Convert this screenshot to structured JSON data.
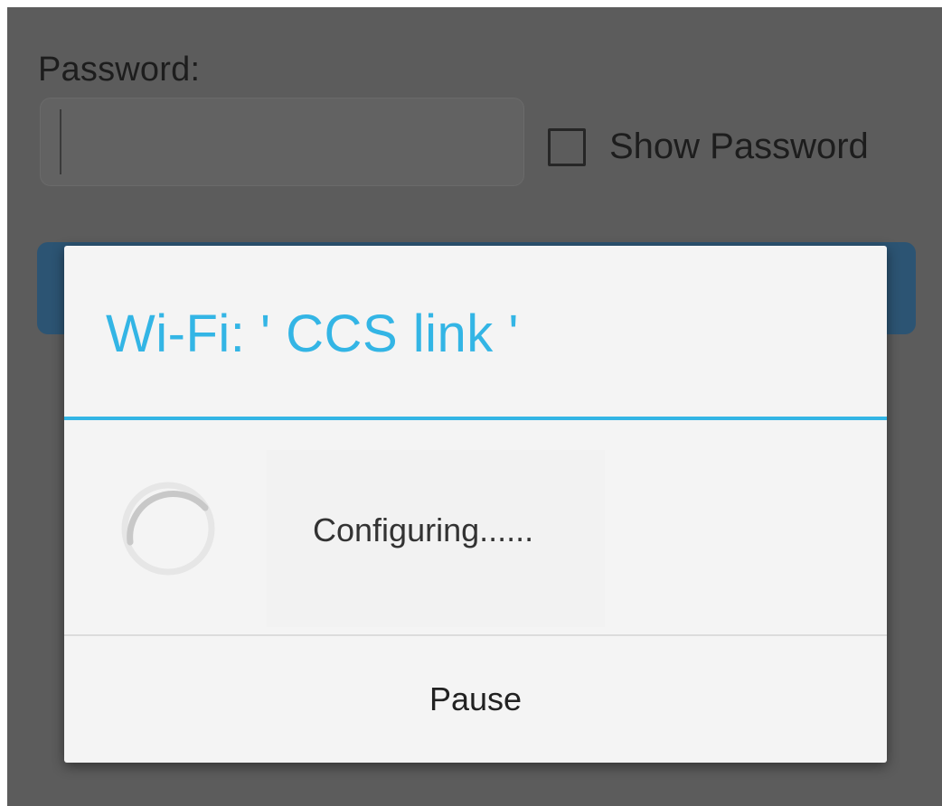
{
  "form": {
    "password_label": "Password:",
    "password_value": "",
    "show_password_label": "Show Password",
    "show_password_checked": false
  },
  "dialog": {
    "title": "Wi-Fi: ' CCS link '",
    "message": "Configuring......",
    "button_label": "Pause",
    "accent_color": "#33b5e5",
    "spinner_icon": "progress-spinner"
  },
  "colors": {
    "overlay_background": "#5c5c5c",
    "background_button": "#2c5473",
    "dialog_background": "#f4f4f4"
  }
}
